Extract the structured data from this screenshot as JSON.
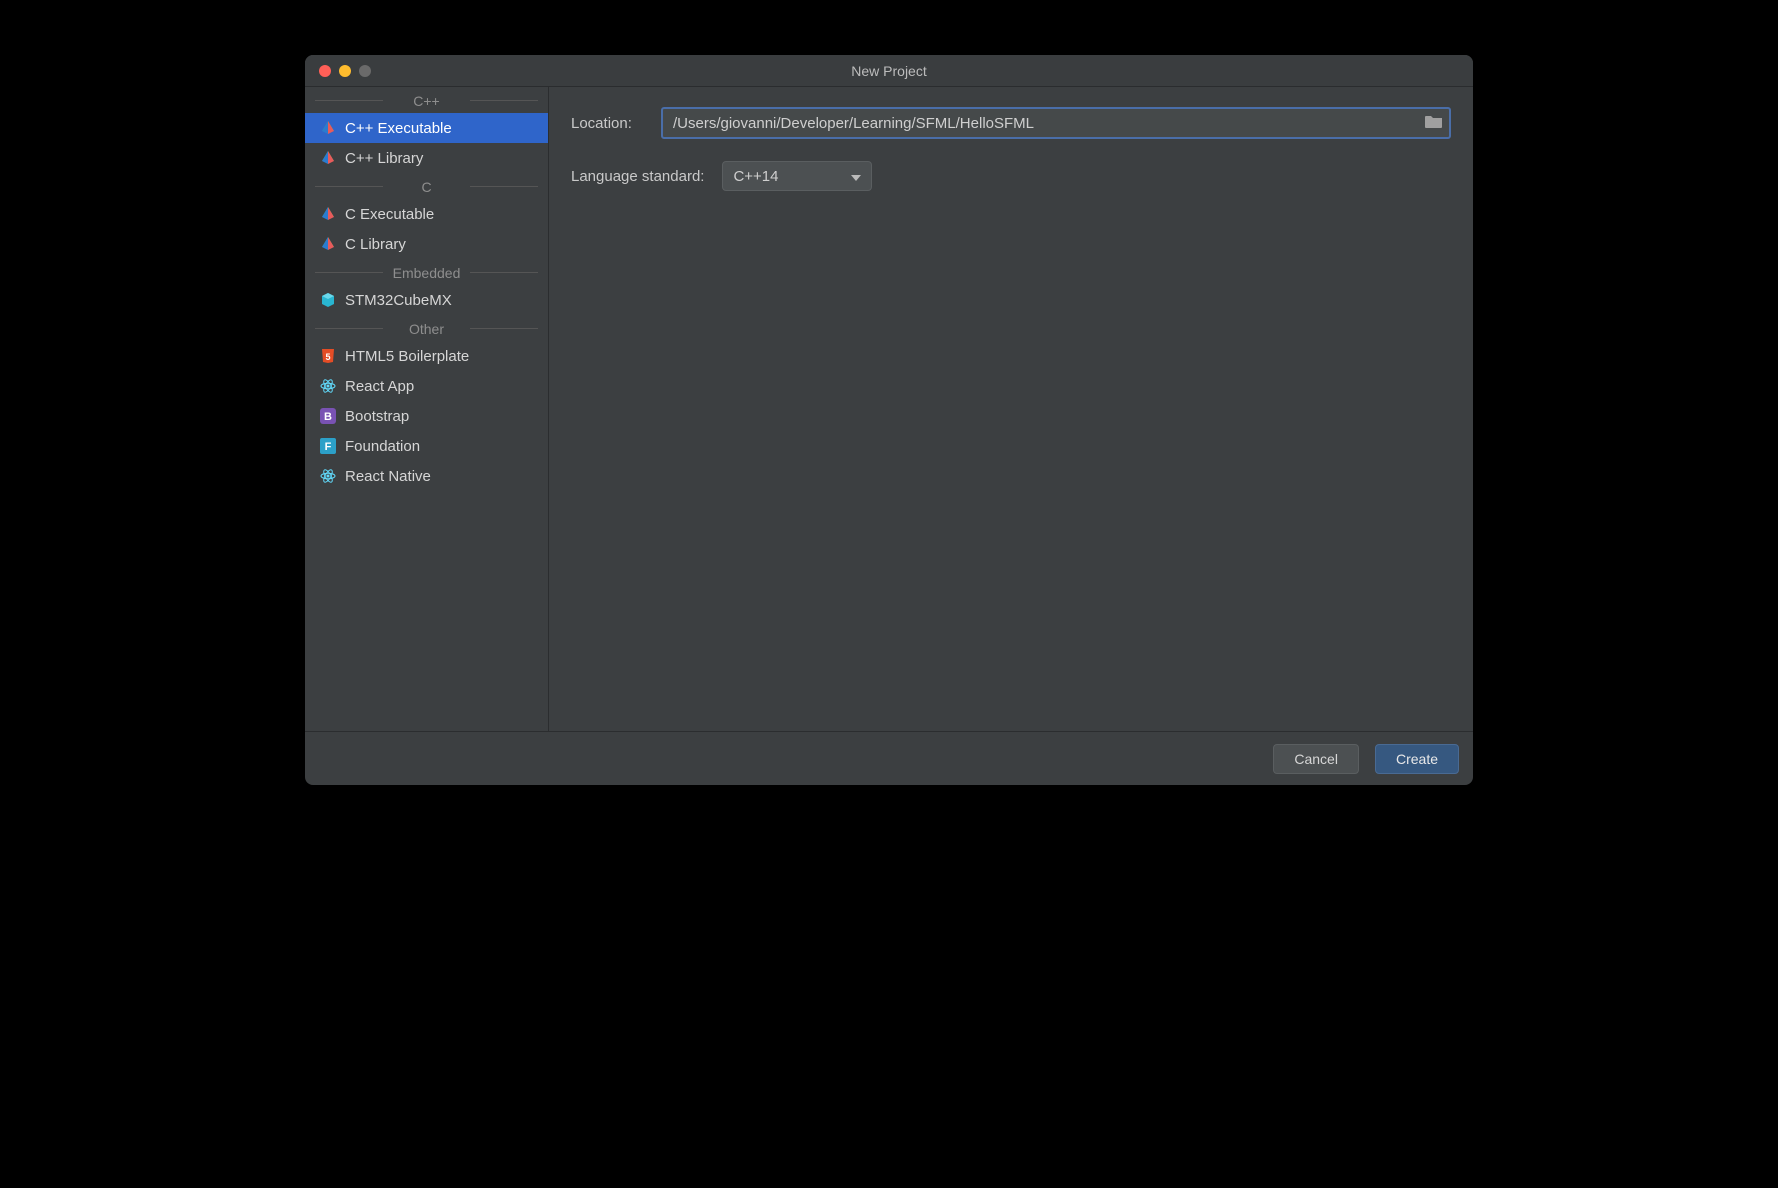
{
  "window": {
    "title": "New Project"
  },
  "sidebar": {
    "sections": [
      {
        "label": "C++",
        "items": [
          {
            "slug": "cpp-executable",
            "label": "C++ Executable",
            "icon": "clion"
          },
          {
            "slug": "cpp-library",
            "label": "C++ Library",
            "icon": "clion"
          }
        ]
      },
      {
        "label": "C",
        "items": [
          {
            "slug": "c-executable",
            "label": "C Executable",
            "icon": "clion"
          },
          {
            "slug": "c-library",
            "label": "C Library",
            "icon": "clion"
          }
        ]
      },
      {
        "label": "Embedded",
        "items": [
          {
            "slug": "stm32cubemx",
            "label": "STM32CubeMX",
            "icon": "cube"
          }
        ]
      },
      {
        "label": "Other",
        "items": [
          {
            "slug": "html5-boilerplate",
            "label": "HTML5 Boilerplate",
            "icon": "html5"
          },
          {
            "slug": "react-app",
            "label": "React App",
            "icon": "react"
          },
          {
            "slug": "bootstrap",
            "label": "Bootstrap",
            "icon": "bootstrap"
          },
          {
            "slug": "foundation",
            "label": "Foundation",
            "icon": "foundation"
          },
          {
            "slug": "react-native",
            "label": "React Native",
            "icon": "react"
          }
        ]
      }
    ],
    "selected": "cpp-executable"
  },
  "form": {
    "location_label": "Location:",
    "location_value": "/Users/giovanni/Developer/Learning/SFML/HelloSFML",
    "language_standard_label": "Language standard:",
    "language_standard_value": "C++14"
  },
  "footer": {
    "cancel_label": "Cancel",
    "create_label": "Create"
  },
  "colors": {
    "selection": "#2f65ca",
    "accent": "#4a6ea9",
    "bg": "#3c3f41"
  }
}
